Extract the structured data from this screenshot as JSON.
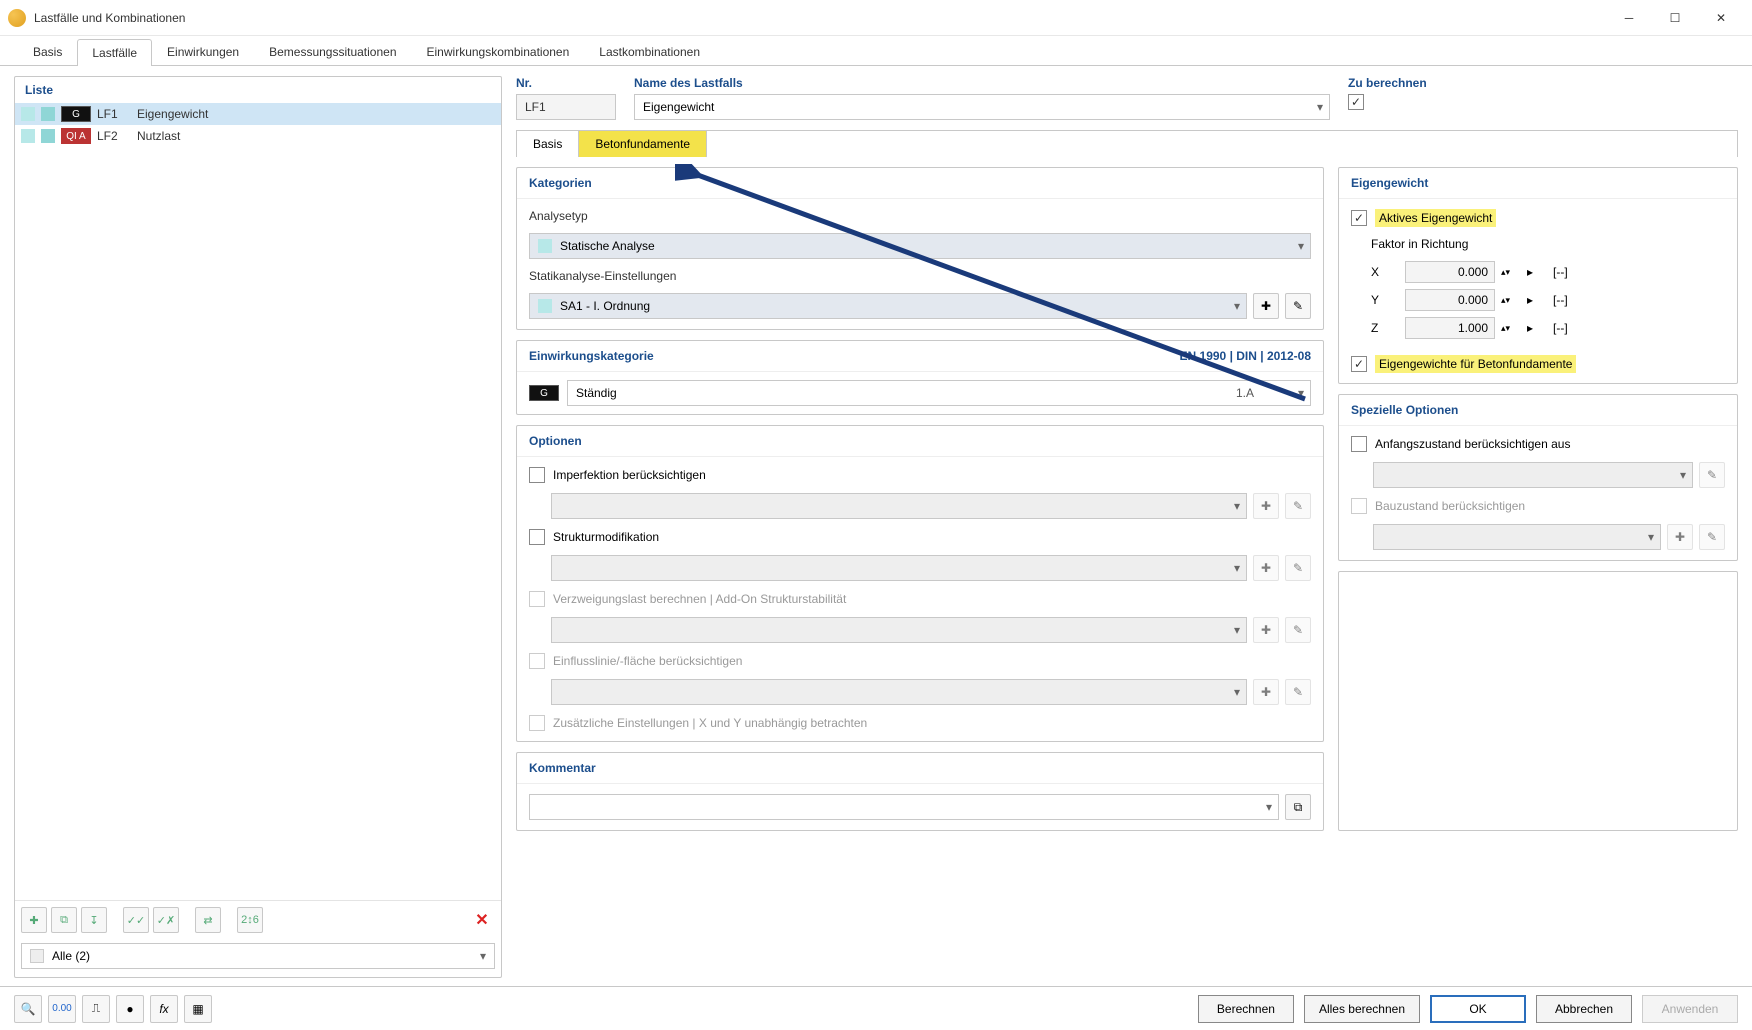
{
  "window": {
    "title": "Lastfälle und Kombinationen"
  },
  "maintabs": {
    "items": [
      "Basis",
      "Lastfälle",
      "Einwirkungen",
      "Bemessungssituationen",
      "Einwirkungskombinationen",
      "Lastkombinationen"
    ],
    "activeIndex": 1
  },
  "left": {
    "header": "Liste",
    "rows": [
      {
        "tag": "G",
        "tagClass": "g",
        "num": "LF1",
        "name": "Eigengewicht",
        "selected": true
      },
      {
        "tag": "QI A",
        "tagClass": "qi",
        "num": "LF2",
        "name": "Nutzlast",
        "selected": false
      }
    ],
    "filter": "Alle (2)"
  },
  "top": {
    "nrLabel": "Nr.",
    "nrValue": "LF1",
    "nameLabel": "Name des Lastfalls",
    "nameValue": "Eigengewicht",
    "zuBerechnen": "Zu berechnen"
  },
  "subtabs": {
    "basis": "Basis",
    "beton": "Betonfundamente"
  },
  "kategorien": {
    "title": "Kategorien",
    "analysetypLabel": "Analysetyp",
    "analysetypValue": "Statische Analyse",
    "statikLabel": "Statikanalyse-Einstellungen",
    "statikValue": "SA1 - I. Ordnung"
  },
  "einwirkung": {
    "title": "Einwirkungskategorie",
    "norm": "EN 1990 | DIN | 2012-08",
    "value": "Ständig",
    "code": "1.A"
  },
  "optionen": {
    "title": "Optionen",
    "imperfektion": "Imperfektion berücksichtigen",
    "struktur": "Strukturmodifikation",
    "verzweigung": "Verzweigungslast berechnen | Add-On Strukturstabilität",
    "einfluss": "Einflusslinie/-fläche berücksichtigen",
    "zusatz": "Zusätzliche Einstellungen | X und Y unabhängig betrachten"
  },
  "eigengewicht": {
    "title": "Eigengewicht",
    "aktives": "Aktives Eigengewicht",
    "faktorLabel": "Faktor in Richtung",
    "x": {
      "label": "X",
      "value": "0.000",
      "unit": "[--]"
    },
    "y": {
      "label": "Y",
      "value": "0.000",
      "unit": "[--]"
    },
    "z": {
      "label": "Z",
      "value": "1.000",
      "unit": "[--]"
    },
    "beton": "Eigengewichte für Betonfundamente"
  },
  "spezielle": {
    "title": "Spezielle Optionen",
    "anfang": "Anfangszustand berücksichtigen aus",
    "bauzustand": "Bauzustand berücksichtigen"
  },
  "kommentar": {
    "title": "Kommentar"
  },
  "bottombuttons": {
    "berechnen": "Berechnen",
    "alles": "Alles berechnen",
    "ok": "OK",
    "abbrechen": "Abbrechen",
    "anwenden": "Anwenden"
  }
}
